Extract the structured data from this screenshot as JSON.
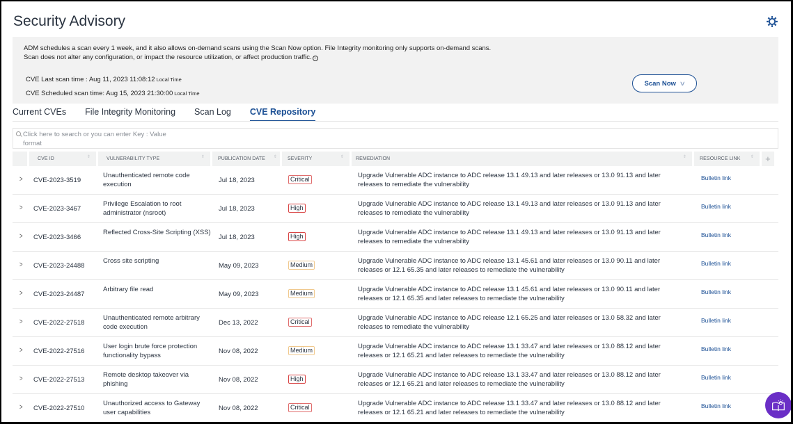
{
  "header": {
    "title": "Security Advisory",
    "settings_icon": "gear-icon"
  },
  "info": {
    "line1": "ADM schedules a scan every 1 week, and it also allows on-demand scans using the Scan Now option. File Integrity monitoring only supports on-demand scans.",
    "line2": "Scan does not alter any configuration, or impact the resource utilization, or affect production traffic.",
    "info_icon": "i",
    "last_scan_label": "CVE Last scan time : Aug 11, 2023 11:08:12",
    "last_scan_suffix": "Local Time",
    "scheduled_scan_label": "CVE Scheduled scan time: Aug 15, 2023 21:30:00",
    "scheduled_scan_suffix": "Local Time",
    "scan_now_label": "Scan Now",
    "scan_now_chevron": "∨"
  },
  "tabs": [
    {
      "label": "Current CVEs",
      "active": false
    },
    {
      "label": "File Integrity Monitoring",
      "active": false
    },
    {
      "label": "Scan Log",
      "active": false
    },
    {
      "label": "CVE Repository",
      "active": true
    }
  ],
  "search": {
    "placeholder_line1": "Click here to search or you can enter Key : Value",
    "placeholder_line2": "format"
  },
  "table": {
    "columns": [
      "CVE ID",
      "VULNERABILITY TYPE",
      "PUBLICATION DATE",
      "SEVERITY",
      "REMEDIATION",
      "RESOURCE LINK"
    ],
    "add_column": "+",
    "sort_glyph": "⇕",
    "expand_glyph": ">",
    "rows": [
      {
        "cve_id": "CVE-2023-3519",
        "type": "Unauthenticated remote code execution",
        "date": "Jul 18, 2023",
        "severity": "Critical",
        "remediation": "Upgrade Vulnerable ADC instance to ADC release 13.1 49.13 and later releases or 13.0 91.13 and later releases to remediate the vulnerability",
        "link": "Bulletin link"
      },
      {
        "cve_id": "CVE-2023-3467",
        "type": "Privilege Escalation to root administrator (nsroot)",
        "date": "Jul 18, 2023",
        "severity": "High",
        "remediation": "Upgrade Vulnerable ADC instance to ADC release 13.1 49.13 and later releases or 13.0 91.13 and later releases to remediate the vulnerability",
        "link": "Bulletin link"
      },
      {
        "cve_id": "CVE-2023-3466",
        "type": "Reflected Cross-Site Scripting (XSS)",
        "date": "Jul 18, 2023",
        "severity": "High",
        "remediation": "Upgrade Vulnerable ADC instance to ADC release 13.1 49.13 and later releases or 13.0 91.13 and later releases to remediate the vulnerability",
        "link": "Bulletin link"
      },
      {
        "cve_id": "CVE-2023-24488",
        "type": "Cross site scripting",
        "date": "May 09, 2023",
        "severity": "Medium",
        "remediation": "Upgrade Vulnerable ADC instance to ADC release 13.1 45.61 and later releases or 13.0 90.11 and later releases or 12.1 65.35 and later releases to remediate the vulnerability",
        "link": "Bulletin link"
      },
      {
        "cve_id": "CVE-2023-24487",
        "type": "Arbitrary file read",
        "date": "May 09, 2023",
        "severity": "Medium",
        "remediation": "Upgrade Vulnerable ADC instance to ADC release 13.1 45.61 and later releases or 13.0 90.11 and later releases or 12.1 65.35 and later releases to remediate the vulnerability",
        "link": "Bulletin link"
      },
      {
        "cve_id": "CVE-2022-27518",
        "type": "Unauthenticated remote arbitrary code execution",
        "date": "Dec 13, 2022",
        "severity": "Critical",
        "remediation": "Upgrade Vulnerable ADC instance to ADC release 12.1 65.25 and later releases or 13.0 58.32 and later releases to remediate the vulnerability",
        "link": "Bulletin link"
      },
      {
        "cve_id": "CVE-2022-27516",
        "type": "User login brute force protection functionality bypass",
        "date": "Nov 08, 2022",
        "severity": "Medium",
        "remediation": "Upgrade Vulnerable ADC instance to ADC release 13.1 33.47 and later releases or 13.0 88.12 and later releases or 12.1 65.21 and later releases to remediate the vulnerability",
        "link": "Bulletin link"
      },
      {
        "cve_id": "CVE-2022-27513",
        "type": "Remote desktop takeover via phishing",
        "date": "Nov 08, 2022",
        "severity": "High",
        "remediation": "Upgrade Vulnerable ADC instance to ADC release 13.1 33.47 and later releases or 13.0 88.12 and later releases or 12.1 65.21 and later releases to remediate the vulnerability",
        "link": "Bulletin link"
      },
      {
        "cve_id": "CVE-2022-27510",
        "type": "Unauthorized access to Gateway user capabilities",
        "date": "Nov 08, 2022",
        "severity": "Critical",
        "remediation": "Upgrade Vulnerable ADC instance to ADC release 13.1 33.47 and later releases or 13.0 88.12 and later releases or 12.1 65.21 and later releases to remediate the vulnerability",
        "link": "Bulletin link"
      }
    ]
  },
  "colors": {
    "accent": "#1b4f94",
    "critical": "#e06e6e",
    "high": "#d94545",
    "medium": "#f0c98e",
    "help_button": "#6a2ec6"
  },
  "help_button": {
    "icon": "book-lightbulb-icon"
  }
}
